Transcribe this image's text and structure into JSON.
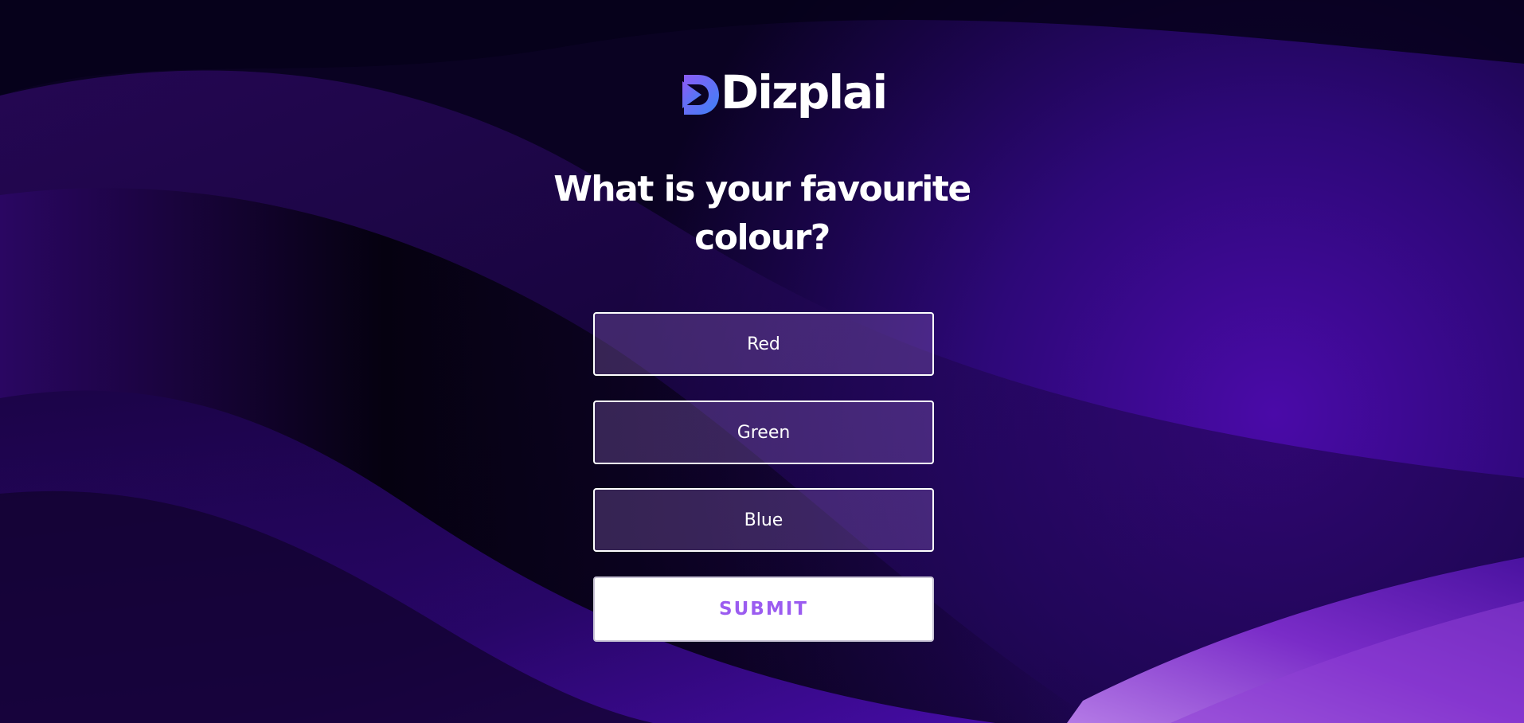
{
  "brand": {
    "name": "Dizplai",
    "logo_icon": "play-triangle-d-icon",
    "logo_gradient": [
      "#8b5cf6",
      "#3b82f6"
    ]
  },
  "poll": {
    "question": "What is your favourite colour?",
    "options": [
      {
        "label": "Red"
      },
      {
        "label": "Green"
      },
      {
        "label": "Blue"
      }
    ],
    "submit_label": "SUBMIT"
  },
  "colors": {
    "accent": "#9b5cf0",
    "background_dark": "#07011a",
    "background_purple": "#3a0a9e"
  }
}
